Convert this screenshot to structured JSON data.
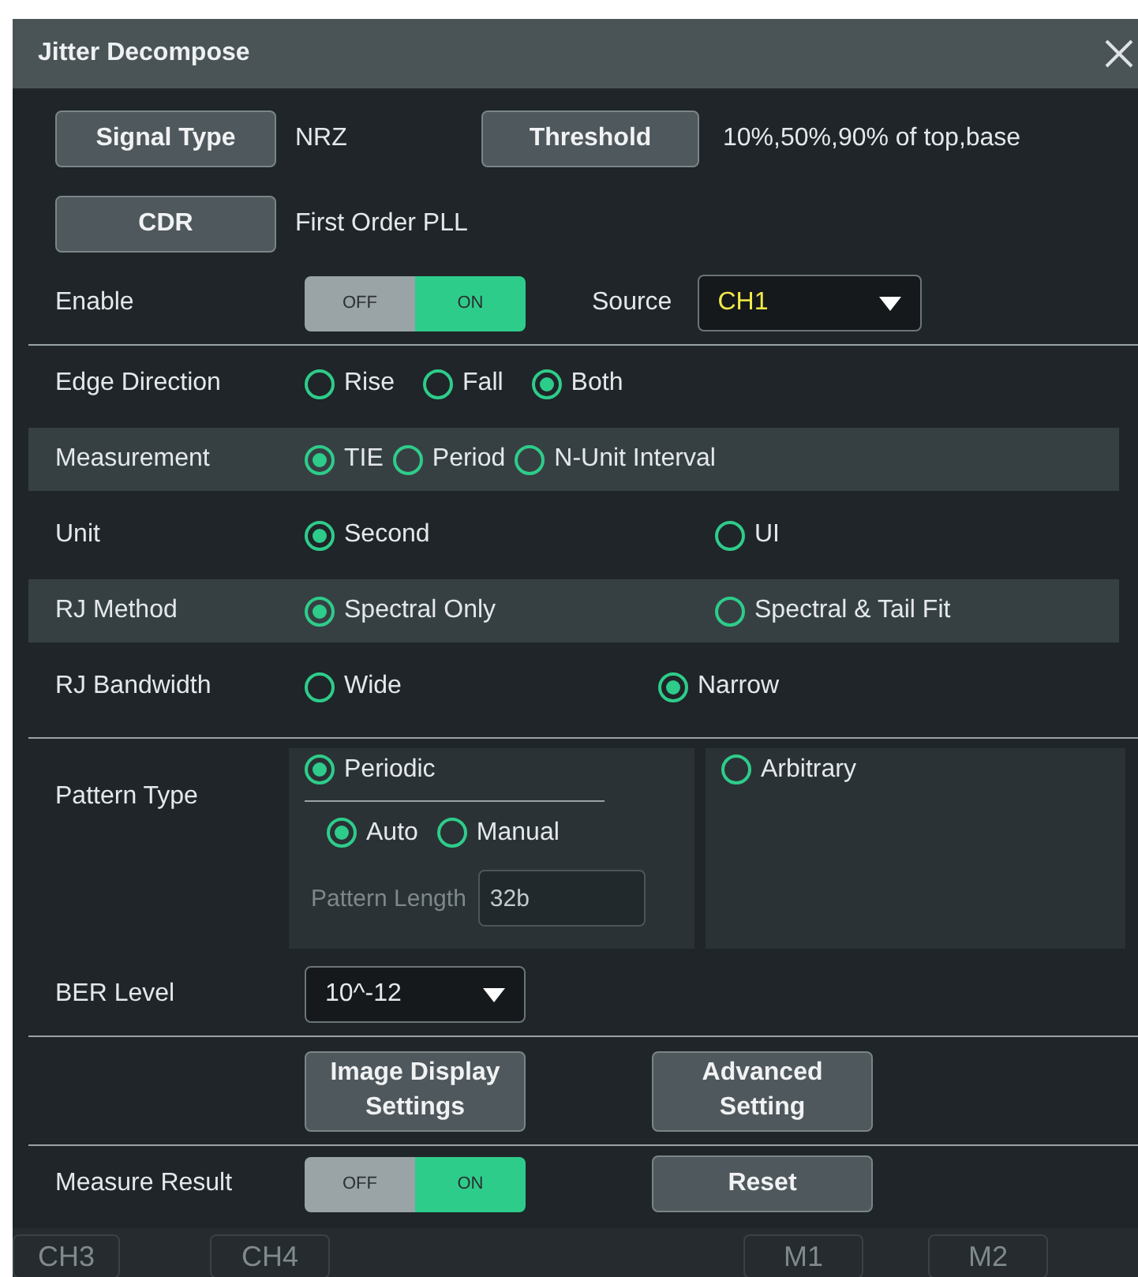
{
  "dialog": {
    "title": "Jitter Decompose"
  },
  "top_buttons": [
    {
      "label": "Signal Type",
      "value": "NRZ"
    },
    {
      "label": "Threshold",
      "value": "10%,50%,90% of top,base"
    }
  ],
  "cdr": {
    "label": "CDR",
    "value": "First Order PLL"
  },
  "enable": {
    "label": "Enable",
    "off_label": "OFF",
    "on_label": "ON",
    "on": true
  },
  "source": {
    "label": "Source",
    "value": "CH1"
  },
  "radio_rows": [
    {
      "label": "Edge Direction",
      "kind": "inline",
      "highlighted": false,
      "options": [
        {
          "label": "Rise",
          "selected": false
        },
        {
          "label": "Fall",
          "selected": false
        },
        {
          "label": "Both",
          "selected": true
        }
      ]
    },
    {
      "label": "Measurement",
      "kind": "tight",
      "highlighted": true,
      "options": [
        {
          "label": "TIE",
          "selected": true
        },
        {
          "label": "Period",
          "selected": false
        },
        {
          "label": "N-Unit Interval",
          "selected": false
        }
      ]
    },
    {
      "label": "Unit",
      "kind": "pair",
      "highlighted": false,
      "options": [
        {
          "label": "Second",
          "selected": true
        },
        {
          "label": "UI",
          "selected": false
        }
      ]
    },
    {
      "label": "RJ Method",
      "kind": "pair",
      "highlighted": true,
      "options": [
        {
          "label": "Spectral Only",
          "selected": true
        },
        {
          "label": "Spectral & Tail Fit",
          "selected": false
        }
      ]
    },
    {
      "label": "RJ Bandwidth",
      "kind": "pair-narrow",
      "highlighted": false,
      "options": [
        {
          "label": "Wide",
          "selected": false
        },
        {
          "label": "Narrow",
          "selected": true
        }
      ]
    }
  ],
  "pattern": {
    "label": "Pattern Type",
    "options": [
      {
        "label": "Periodic",
        "selected": true
      },
      {
        "label": "Arbitrary",
        "selected": false
      }
    ],
    "sub_options": [
      {
        "label": "Auto",
        "selected": true
      },
      {
        "label": "Manual",
        "selected": false
      }
    ],
    "length": {
      "label": "Pattern Length",
      "value": "32b",
      "disabled": true
    }
  },
  "ber": {
    "label": "BER Level",
    "value": "10^-12"
  },
  "action_buttons": [
    "Image Display\nSettings",
    "Advanced\nSetting"
  ],
  "measure_result": {
    "label": "Measure Result",
    "off_label": "OFF",
    "on_label": "ON",
    "on": true,
    "reset": "Reset"
  },
  "bottom_bar": [
    "CH3",
    "CH4",
    "M1",
    "M2"
  ]
}
